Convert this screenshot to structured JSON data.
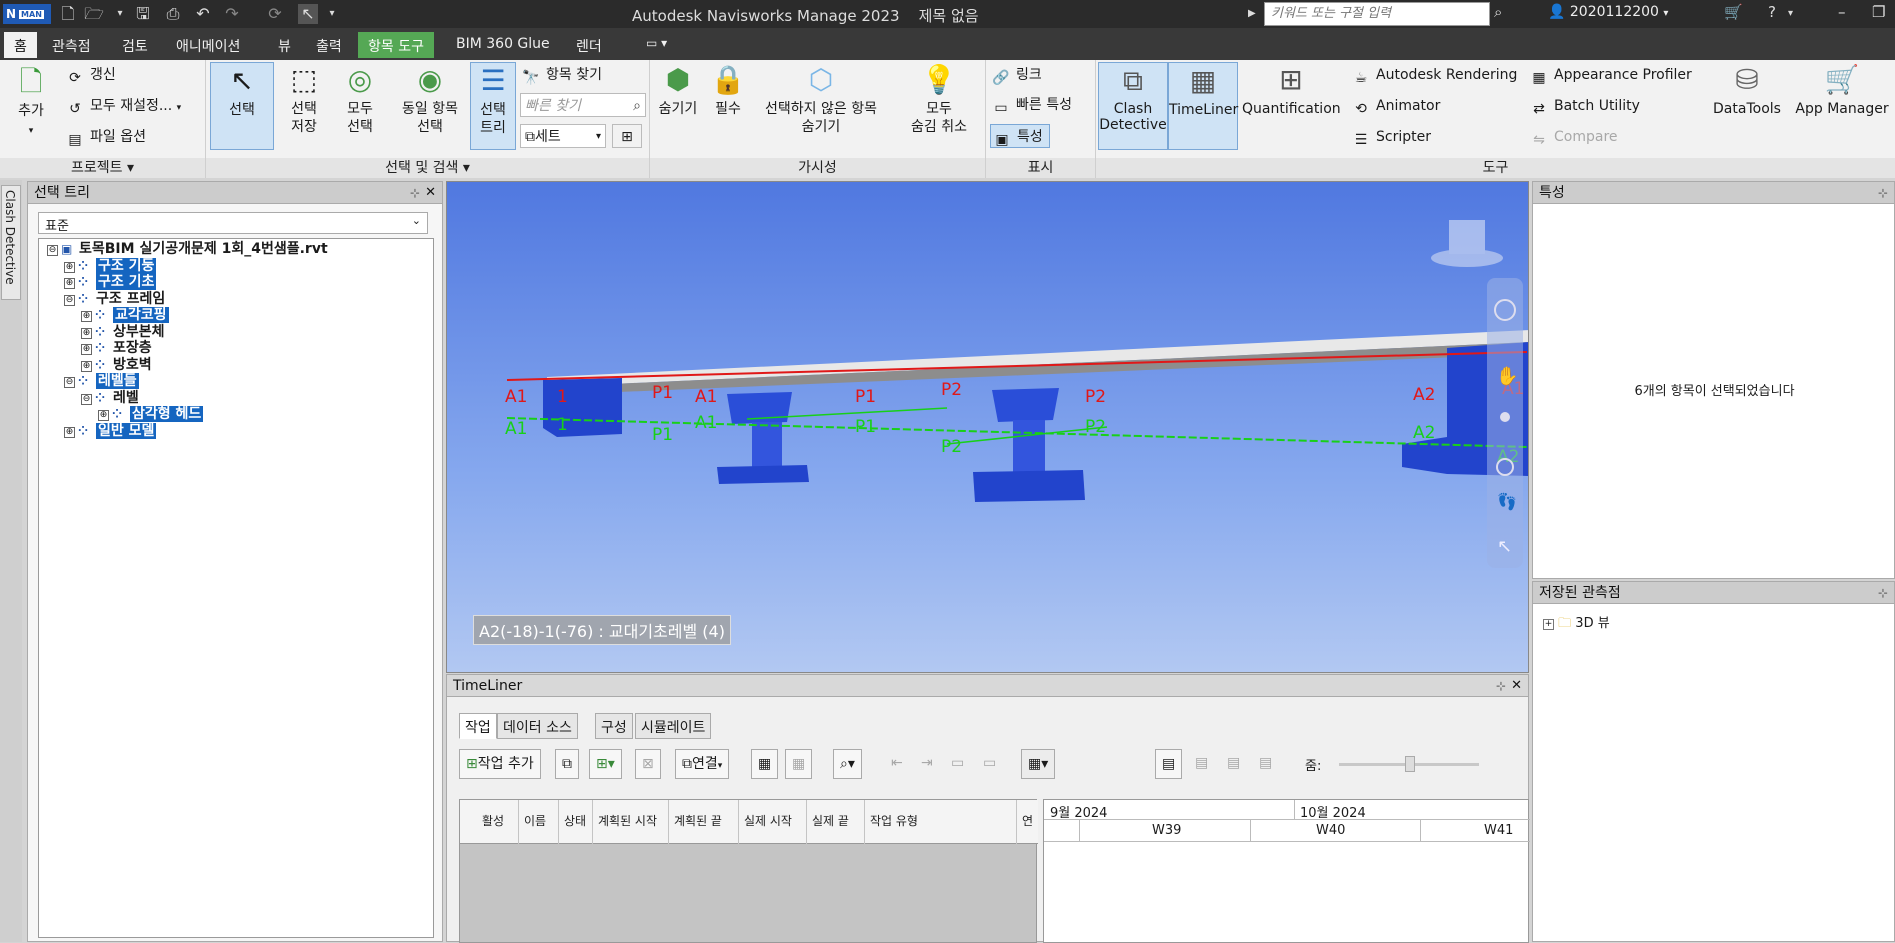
{
  "titlebar": {
    "logo_text": "N",
    "logo_sub": "MAN",
    "title": "Autodesk Navisworks Manage 2023",
    "doc": "제목 없음",
    "search_placeholder": "키워드 또는 구절 입력",
    "user": "2020112200"
  },
  "tabs": [
    "홈",
    "관측점",
    "검토",
    "애니메이션",
    "뷰",
    "출력",
    "항목 도구",
    "BIM 360 Glue",
    "렌더"
  ],
  "ribbon": {
    "project": {
      "title": "프로젝트 ▾",
      "add": "추가",
      "refresh": "갱신",
      "reload_all": "모두 재설정...",
      "file_options": "파일 옵션"
    },
    "select": {
      "title": "선택 및 검색 ▾",
      "select": "선택",
      "save_selection": "선택\n저장",
      "select_all": "모두\n선택",
      "select_same": "동일 항목\n선택",
      "selection_tree": "선택\n트리",
      "find_items": "항목 찾기",
      "quick_find_placeholder": "빠른 찾기",
      "sets": "세트"
    },
    "visibility": {
      "title": "가시성",
      "hide": "숨기기",
      "require": "필수",
      "hide_unselected": "선택하지 않은 항목\n숨기기",
      "unhide_all": "모두\n숨김 취소"
    },
    "display": {
      "title": "표시",
      "links": "링크",
      "quick_props": "빠른 특성",
      "properties": "특성"
    },
    "tools": {
      "title": "도구",
      "clash": "Clash\nDetective",
      "timeliner": "TimeLiner",
      "quantification": "Quantification",
      "rendering": "Autodesk Rendering",
      "animator": "Animator",
      "scripter": "Scripter",
      "appearance": "Appearance Profiler",
      "batch": "Batch Utility",
      "compare": "Compare",
      "datatools": "DataTools",
      "appmanager": "App Manager"
    }
  },
  "left_tab": "Clash Detective",
  "selection_tree": {
    "title": "선택 트리",
    "combo": "표준",
    "items": [
      {
        "label": "토목BIM 실기공개문제 1회_4번샘플.rvt",
        "level": 0,
        "pm": "⊖",
        "hl": false
      },
      {
        "label": "구조 기둥",
        "level": 1,
        "pm": "⊕",
        "hl": true
      },
      {
        "label": "구조 기초",
        "level": 1,
        "pm": "⊕",
        "hl": true
      },
      {
        "label": "구조 프레임",
        "level": 1,
        "pm": "⊖",
        "hl": false
      },
      {
        "label": "교각코핑",
        "level": 2,
        "pm": "⊕",
        "hl": true
      },
      {
        "label": "상부본체",
        "level": 2,
        "pm": "⊕",
        "hl": false
      },
      {
        "label": "포장층",
        "level": 2,
        "pm": "⊕",
        "hl": false
      },
      {
        "label": "방호벽",
        "level": 2,
        "pm": "⊕",
        "hl": false
      },
      {
        "label": "레벨들",
        "level": 1,
        "pm": "⊖",
        "hl": true
      },
      {
        "label": "레벨",
        "level": 2,
        "pm": "⊖",
        "hl": false
      },
      {
        "label": "삼각형 헤드",
        "level": 3,
        "pm": "⊕",
        "hl": true
      },
      {
        "label": "일반 모델",
        "level": 1,
        "pm": "⊕",
        "hl": true
      }
    ]
  },
  "viewport": {
    "tooltip": "A2(-18)-1(-76) : 교대기초레벨 (4)",
    "labels_red": [
      "A1",
      "1",
      "P1",
      "A1",
      "P1",
      "P2",
      "P2",
      "A2",
      "A1"
    ],
    "labels_green": [
      "A1",
      "1",
      "P1",
      "A1",
      "P1",
      "P2",
      "P2",
      "A2",
      "A2"
    ]
  },
  "timeliner": {
    "title": "TimeLiner",
    "tabs": [
      "작업",
      "데이터 소스",
      "구성",
      "시뮬레이트"
    ],
    "add_task": "작업 추가",
    "link": "연결",
    "zoom": "줌:",
    "columns": [
      "활성",
      "이름",
      "상태",
      "계획된 시작",
      "계획된 끝",
      "실제 시작",
      "실제 끝",
      "작업 유형",
      "연"
    ],
    "months": [
      "9월 2024",
      "10월 2024"
    ],
    "weeks": [
      "W39",
      "W40",
      "W41"
    ]
  },
  "properties": {
    "title": "특성",
    "message": "6개의 항목이 선택되었습니다"
  },
  "saved_views": {
    "title": "저장된 관측점",
    "item": "3D 뷰"
  }
}
